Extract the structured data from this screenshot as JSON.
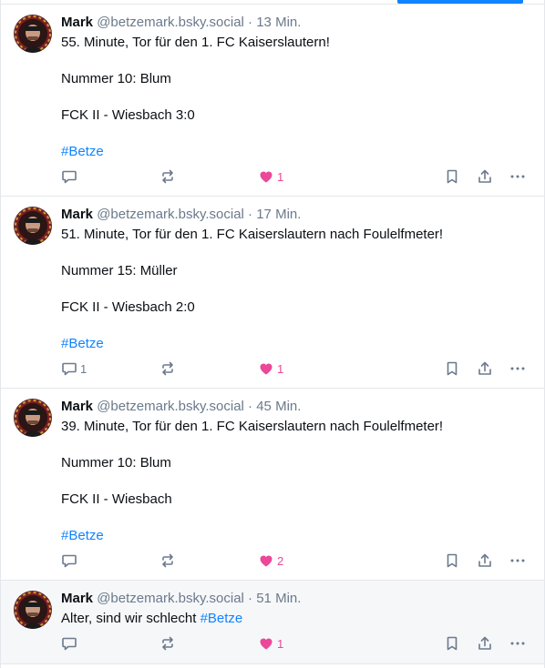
{
  "posts": [
    {
      "name": "Mark",
      "handle": "@betzemark.bsky.social",
      "sep": "·",
      "time": "13 Min.",
      "line1": "55. Minute, Tor für den 1. FC Kaiserslautern!",
      "line2": "Nummer 10: Blum",
      "line3": "FCK II - Wiesbach 3:0",
      "hashtag": "#Betze",
      "reply_count": "",
      "like_count": "1"
    },
    {
      "name": "Mark",
      "handle": "@betzemark.bsky.social",
      "sep": "·",
      "time": "17 Min.",
      "line1": "51. Minute, Tor für den 1. FC Kaiserslautern nach Foulelfmeter!",
      "line2": "Nummer 15: Müller",
      "line3": "FCK II - Wiesbach 2:0",
      "hashtag": "#Betze",
      "reply_count": "1",
      "like_count": "1"
    },
    {
      "name": "Mark",
      "handle": "@betzemark.bsky.social",
      "sep": "·",
      "time": "45 Min.",
      "line1": "39. Minute, Tor für den 1. FC Kaiserslautern nach Foulelfmeter!",
      "line2": "Nummer 10: Blum",
      "line3": "FCK II - Wiesbach",
      "hashtag": "#Betze",
      "reply_count": "",
      "like_count": "2"
    },
    {
      "name": "Mark",
      "handle": "@betzemark.bsky.social",
      "sep": "·",
      "time": "51 Min.",
      "line1": "Alter, sind wir schlecht",
      "hashtag": "#Betze",
      "reply_count": "",
      "like_count": "1"
    }
  ],
  "icons": {
    "reply": "reply-icon",
    "repost": "repost-icon",
    "like": "heart-icon",
    "bookmark": "bookmark-icon",
    "share": "share-icon",
    "more": "more-icon"
  },
  "colors": {
    "accent": "#1083fe",
    "like": "#ec4899",
    "muted": "#6b7a8c",
    "border": "#e4e7eb"
  }
}
